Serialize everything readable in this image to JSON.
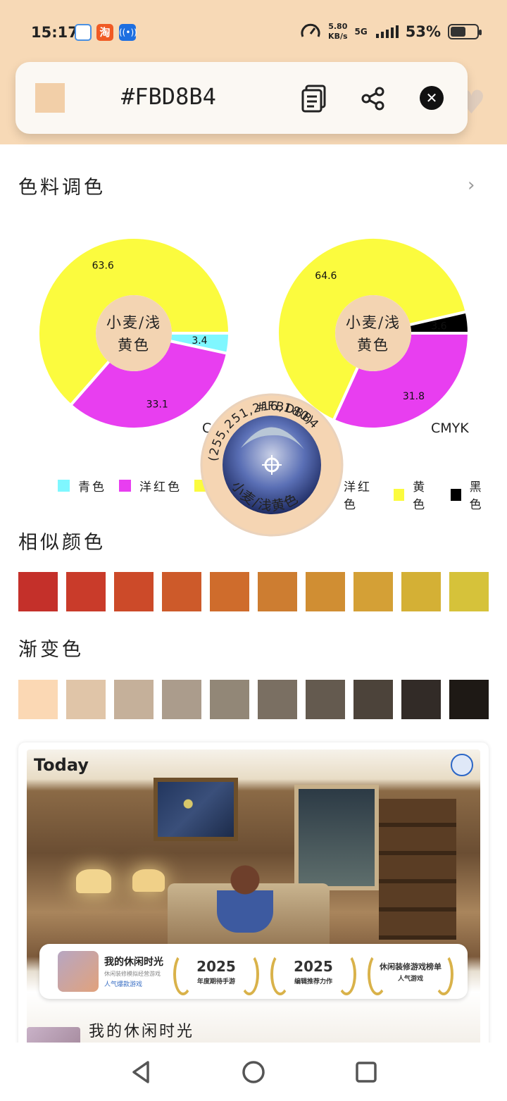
{
  "status_bar": {
    "time": "15:17",
    "speed_value": "5.80",
    "speed_unit": "KB/s",
    "network": "5G",
    "battery": "53%",
    "apps": [
      {
        "name": "phone-manager-icon",
        "color": "#4a90e2"
      },
      {
        "name": "taobao-icon",
        "color": "#f05a24",
        "glyph": "淘"
      },
      {
        "name": "nfc-icon",
        "color": "#1e6fe0"
      }
    ]
  },
  "header": {
    "ghost_title": "#FBD8B4",
    "hex": "#FBD8B4",
    "swatch_color": "#f2cfa8",
    "copy_icon": "document-icon",
    "share_icon": "share-icon",
    "close_icon": "close-icon"
  },
  "sections": {
    "pigment": "色料调色",
    "similar": "相似颜色",
    "gradient": "渐变色"
  },
  "color_name": "小麦/浅黄色",
  "color_name_line1": "小麦/浅",
  "color_name_line2": "黄色",
  "medallion": {
    "hex": "#FBD8B4",
    "rgb": "(255,251,216,180)",
    "name": "小麦/浅黄色"
  },
  "chart_data": [
    {
      "type": "pie",
      "slices": [
        {
          "label": "青色",
          "value": 3.4,
          "color": "#7ff7ff"
        },
        {
          "label": "洋红色",
          "value": 33.1,
          "color": "#e83ef0"
        },
        {
          "label": "黄色",
          "value": 63.6,
          "color": "#fbfb3e"
        }
      ],
      "partial_label": "C"
    },
    {
      "type": "pie",
      "title": "CMYK",
      "slices": [
        {
          "label": "青色",
          "value": 0.0,
          "color": "#7ff7ff"
        },
        {
          "label": "洋红色",
          "value": 31.8,
          "color": "#e83ef0"
        },
        {
          "label": "黄色",
          "value": 64.6,
          "color": "#fbfb3e"
        },
        {
          "label": "黑色",
          "value": 3.6,
          "color": "#000000"
        }
      ]
    }
  ],
  "legend_left": [
    {
      "label": "青色",
      "color": "#7ff7ff"
    },
    {
      "label": "洋红色",
      "color": "#e83ef0"
    },
    {
      "label": "黄",
      "color": "#fbfb3e"
    }
  ],
  "legend_right": [
    {
      "label": "洋红色",
      "color": "#e83ef0"
    },
    {
      "label": "黄色",
      "color": "#fbfb3e"
    },
    {
      "label": "黑色",
      "color": "#000000"
    }
  ],
  "similar_colors": [
    "#c4302a",
    "#c93b2a",
    "#cc4a29",
    "#cd5a2a",
    "#cf6c2c",
    "#cd7d31",
    "#d08e33",
    "#d4a036",
    "#d4b035",
    "#d6c23a"
  ],
  "gradient_colors": [
    "#fbd8b4",
    "#e0c5a8",
    "#c5b09a",
    "#ab9c8c",
    "#928777",
    "#7a6f62",
    "#645a4f",
    "#4c433a",
    "#322b27",
    "#1e1915"
  ],
  "ad": {
    "header": "Today",
    "game_name": "我的休闲时光",
    "game_sub": "休闲装修模拟经营游戏",
    "game_tag": "人气爆款游戏",
    "awards": [
      {
        "big": "2025",
        "small": "年度期待手游"
      },
      {
        "big": "2025",
        "small": "编辑推荐力作"
      },
      {
        "big": "休闲装修游戏榜单",
        "small": "人气游戏"
      }
    ],
    "title": "我的休闲时光"
  },
  "nav": {
    "back_icon": "back-triangle-icon",
    "home_icon": "home-circle-icon",
    "recents_icon": "recents-square-icon"
  }
}
